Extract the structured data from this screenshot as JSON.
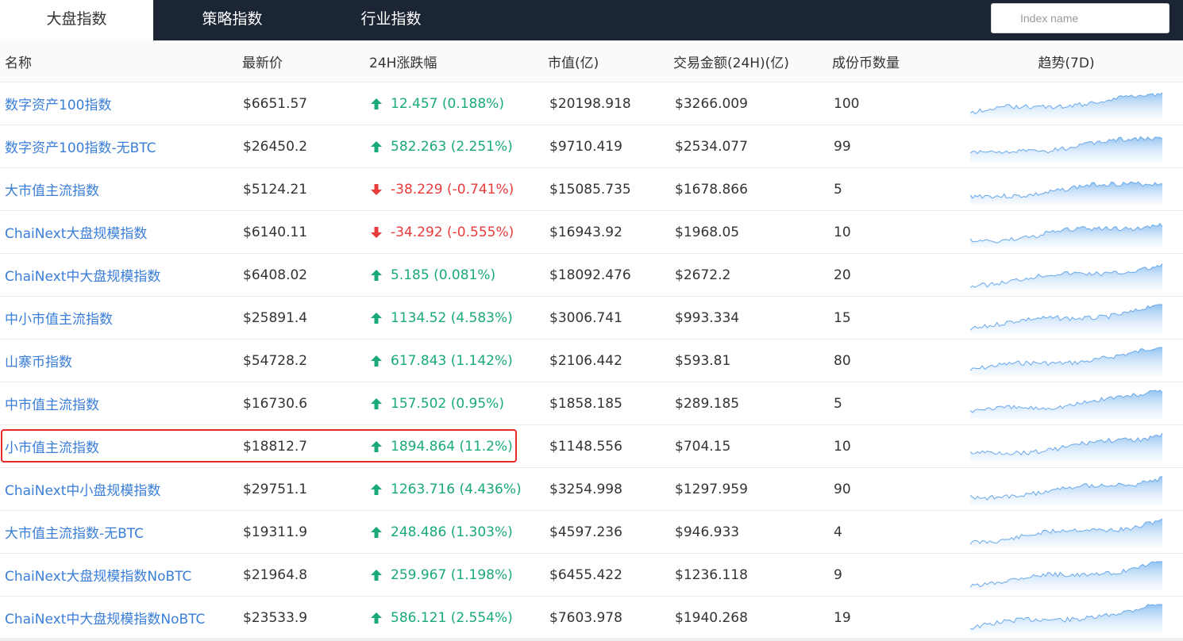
{
  "tabs": [
    {
      "label": "大盘指数",
      "active": true
    },
    {
      "label": "策略指数",
      "active": false
    },
    {
      "label": "行业指数",
      "active": false
    }
  ],
  "search": {
    "placeholder": "Index name",
    "value": ""
  },
  "columns": [
    "名称",
    "最新价",
    "24H涨跌幅",
    "市值(亿)",
    "交易金额(24H)(亿)",
    "成份币数量",
    "趋势(7D)"
  ],
  "colors": {
    "up": "#1aa97b",
    "down": "#e93b3b",
    "link": "#3a7ed8",
    "highlight": "#e62a2a",
    "spark_line": "#6aa9ea"
  },
  "rows": [
    {
      "name": "数字资产100指数",
      "price": "$6651.57",
      "dir": "up",
      "change": "12.457 (0.188%)",
      "mcap": "$20198.918",
      "volume": "$3266.009",
      "count": "100"
    },
    {
      "name": "数字资产100指数-无BTC",
      "price": "$26450.2",
      "dir": "up",
      "change": "582.263 (2.251%)",
      "mcap": "$9710.419",
      "volume": "$2534.077",
      "count": "99"
    },
    {
      "name": "大市值主流指数",
      "price": "$5124.21",
      "dir": "down",
      "change": "-38.229 (-0.741%)",
      "mcap": "$15085.735",
      "volume": "$1678.866",
      "count": "5"
    },
    {
      "name": "ChaiNext大盘规模指数",
      "price": "$6140.11",
      "dir": "down",
      "change": "-34.292 (-0.555%)",
      "mcap": "$16943.92",
      "volume": "$1968.05",
      "count": "10"
    },
    {
      "name": "ChaiNext中大盘规模指数",
      "price": "$6408.02",
      "dir": "up",
      "change": "5.185 (0.081%)",
      "mcap": "$18092.476",
      "volume": "$2672.2",
      "count": "20"
    },
    {
      "name": "中小市值主流指数",
      "price": "$25891.4",
      "dir": "up",
      "change": "1134.52 (4.583%)",
      "mcap": "$3006.741",
      "volume": "$993.334",
      "count": "15"
    },
    {
      "name": "山寨币指数",
      "price": "$54728.2",
      "dir": "up",
      "change": "617.843 (1.142%)",
      "mcap": "$2106.442",
      "volume": "$593.81",
      "count": "80"
    },
    {
      "name": "中市值主流指数",
      "price": "$16730.6",
      "dir": "up",
      "change": "157.502 (0.95%)",
      "mcap": "$1858.185",
      "volume": "$289.185",
      "count": "5"
    },
    {
      "name": "小市值主流指数",
      "price": "$18812.7",
      "dir": "up",
      "change": "1894.864 (11.2%)",
      "mcap": "$1148.556",
      "volume": "$704.15",
      "count": "10"
    },
    {
      "name": "ChaiNext中小盘规模指数",
      "price": "$29751.1",
      "dir": "up",
      "change": "1263.716 (4.436%)",
      "mcap": "$3254.998",
      "volume": "$1297.959",
      "count": "90"
    },
    {
      "name": "大市值主流指数-无BTC",
      "price": "$19311.9",
      "dir": "up",
      "change": "248.486 (1.303%)",
      "mcap": "$4597.236",
      "volume": "$946.933",
      "count": "4"
    },
    {
      "name": "ChaiNext大盘规模指数NoBTC",
      "price": "$21964.8",
      "dir": "up",
      "change": "259.967 (1.198%)",
      "mcap": "$6455.422",
      "volume": "$1236.118",
      "count": "9"
    },
    {
      "name": "ChaiNext中大盘规模指数NoBTC",
      "price": "$23533.9",
      "dir": "up",
      "change": "586.121 (2.554%)",
      "mcap": "$7603.978",
      "volume": "$1940.268",
      "count": "19"
    }
  ],
  "highlighted_row": 8
}
